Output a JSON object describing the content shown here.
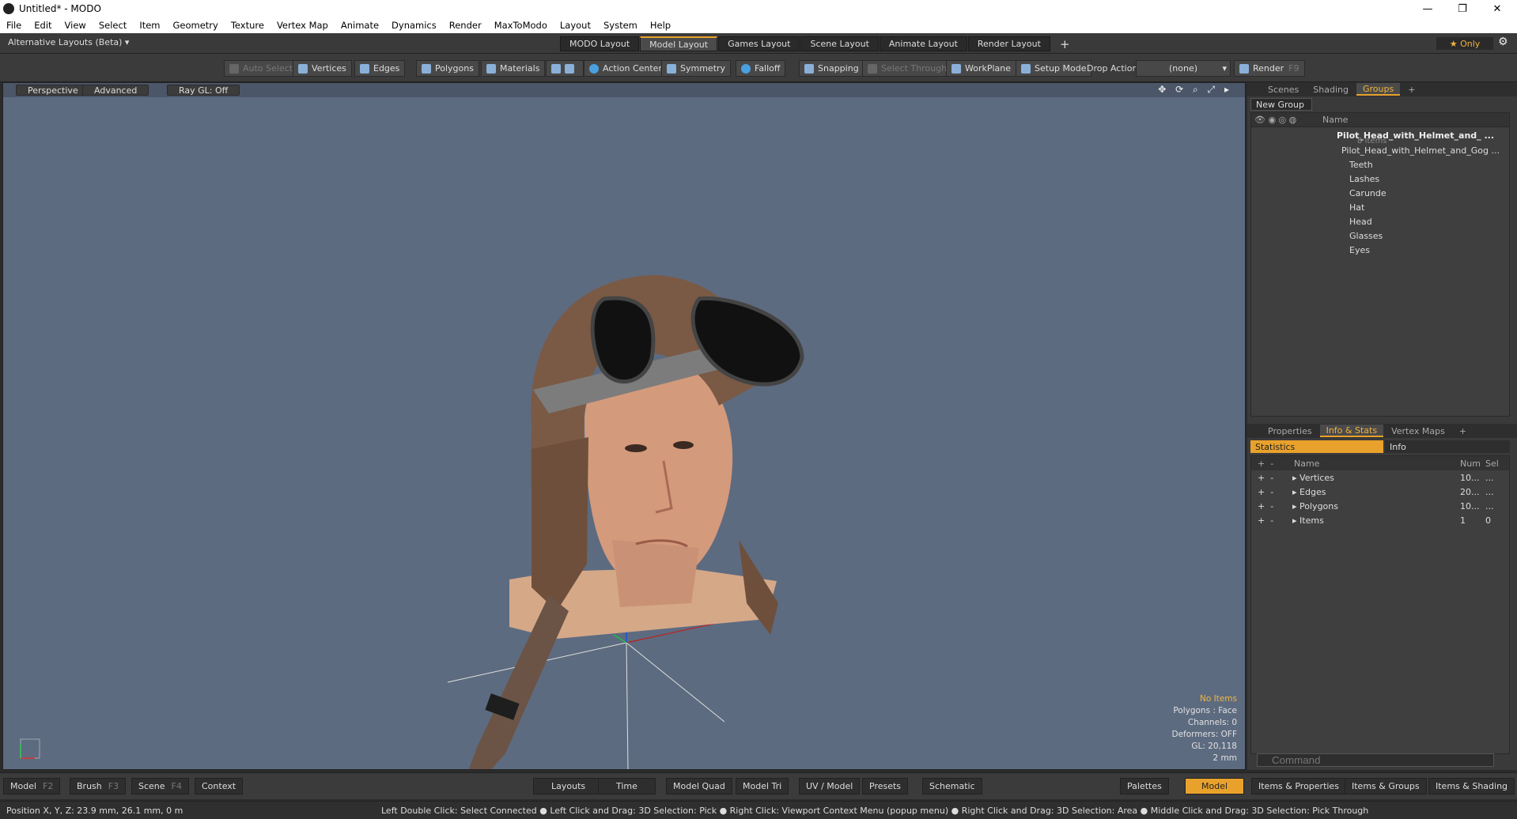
{
  "window": {
    "title": "Untitled* - MODO",
    "min": "—",
    "max": "❐",
    "close": "✕"
  },
  "menu": [
    "File",
    "Edit",
    "View",
    "Select",
    "Item",
    "Geometry",
    "Texture",
    "Vertex Map",
    "Animate",
    "Dynamics",
    "Render",
    "MaxToModo",
    "Layout",
    "System",
    "Help"
  ],
  "layoutbar": {
    "alt": "Alternative Layouts (Beta) ▾",
    "tabs": [
      "MODO Layout",
      "Model Layout",
      "Games Layout",
      "Scene Layout",
      "Animate Layout",
      "Render Layout"
    ],
    "active": "Model Layout",
    "plus": "+",
    "only": "★  Only"
  },
  "toolbar": {
    "auto_select": "Auto Select",
    "vertices": "Vertices",
    "edges": "Edges",
    "polygons": "Polygons",
    "materials": "Materials",
    "action_center": "Action Center",
    "symmetry": "Symmetry",
    "falloff": "Falloff",
    "snapping": "Snapping",
    "select_through": "Select Through",
    "workplane": "WorkPlane",
    "setup_mode": "Setup Mode",
    "drop_action": "Drop Action",
    "none": "(none)",
    "render": "Render",
    "render_key": "F9"
  },
  "viewport": {
    "perspective": "Perspective",
    "advanced": "Advanced",
    "raygl": "Ray GL: Off",
    "icons": "✥ ⟳ ⌕ ⤢ ▸",
    "stats": {
      "items": "No Items",
      "polygons": "Polygons : Face",
      "channels": "Channels: 0",
      "deformers": "Deformers: OFF",
      "gl": "GL: 20,118",
      "scale": "2 mm"
    }
  },
  "groups_panel": {
    "tabs": [
      "Scenes",
      "Shading",
      "Groups"
    ],
    "active": "Groups",
    "plus": "+",
    "new_group": "New Group",
    "name_header": "Name",
    "root": "Pilot_Head_with_Helmet_and_ ...",
    "root_count": "8 Items",
    "items": [
      "Pilot_Head_with_Helmet_and_Gog ...",
      "Teeth",
      "Lashes",
      "Carunde",
      "Hat",
      "Head",
      "Glasses",
      "Eyes"
    ]
  },
  "info_panel": {
    "tabs": [
      "Properties",
      "Info & Stats",
      "Vertex Maps"
    ],
    "active": "Info & Stats",
    "plus": "+",
    "statistics": "Statistics",
    "info": "Info",
    "headers": {
      "name": "Name",
      "num": "Num",
      "sel": "Sel"
    },
    "rows": [
      {
        "name": "Vertices",
        "num": "10...",
        "sel": "..."
      },
      {
        "name": "Edges",
        "num": "20...",
        "sel": "..."
      },
      {
        "name": "Polygons",
        "num": "10...",
        "sel": "..."
      },
      {
        "name": "Items",
        "num": "1",
        "sel": "0"
      }
    ]
  },
  "command": {
    "placeholder": "Command"
  },
  "bottom": {
    "model": "Model",
    "f2": "F2",
    "brush": "Brush",
    "f3": "F3",
    "scene": "Scene",
    "f4": "F4",
    "context": "Context",
    "layouts": "Layouts",
    "time": "Time",
    "model_quad": "Model Quad",
    "model_tri": "Model Tri",
    "uv_model": "UV / Model",
    "presets": "Presets",
    "schematic": "Schematic",
    "palettes": "Palettes",
    "model_active": "Model",
    "items_props": "Items & Properties",
    "items_groups": "Items & Groups",
    "items_shading": "Items & Shading"
  },
  "status": {
    "position": "Position X, Y, Z:   23.9 mm, 26.1 mm, 0 m",
    "hints": "Left Double Click: Select Connected ● Left Click and Drag: 3D Selection: Pick ● Right Click: Viewport Context Menu (popup menu) ● Right Click and Drag: 3D Selection: Area ● Middle Click and Drag: 3D Selection: Pick Through"
  }
}
